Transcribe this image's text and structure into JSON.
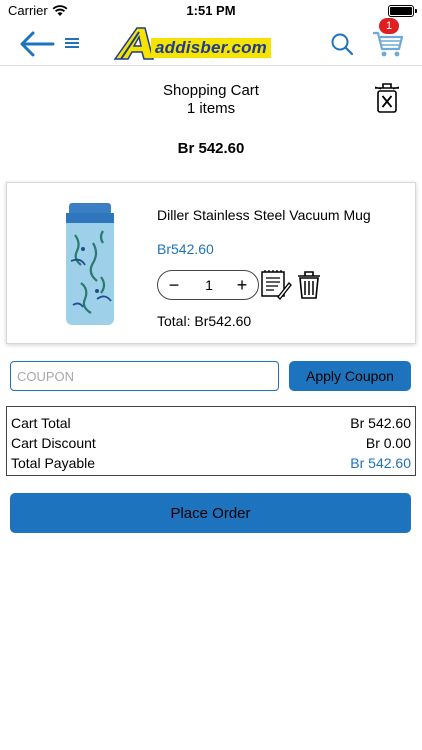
{
  "status_bar": {
    "carrier": "Carrier",
    "time": "1:51 PM",
    "battery_level": 1.0
  },
  "nav": {
    "logo_text": "addisber.com",
    "cart_badge": "1",
    "icons": [
      "back-arrow-icon",
      "menu-icon",
      "search-icon",
      "cart-icon"
    ]
  },
  "colors": {
    "accent": "#1e73be",
    "logo_yellow": "#f5e400",
    "logo_blue": "#1f3a93",
    "badge_red": "#e02020"
  },
  "header": {
    "title": "Shopping Cart",
    "item_count": "1 items",
    "amount": "Br 542.60"
  },
  "product": {
    "name": "Diller Stainless Steel Vacuum Mug",
    "price": "Br542.60",
    "quantity": "1",
    "minus": "−",
    "plus": "+",
    "total": "Total: Br542.60"
  },
  "coupon": {
    "placeholder": "COUPON",
    "button_label": "Apply Coupon"
  },
  "summary": {
    "rows": [
      {
        "label": "Cart Total",
        "value": "Br 542.60"
      },
      {
        "label": "Cart Discount",
        "value": "Br 0.00"
      },
      {
        "label": "Total Payable",
        "value": "Br 542.60"
      }
    ]
  },
  "actions": {
    "place_order": "Place Order"
  }
}
